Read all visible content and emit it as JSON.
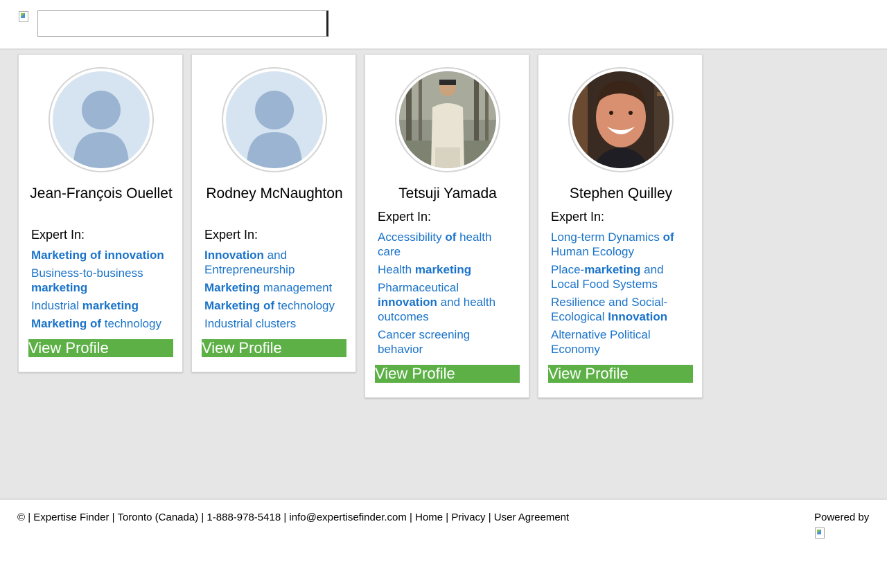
{
  "header": {
    "logo_icon": "broken-image-icon",
    "search": {
      "value": "",
      "placeholder": ""
    }
  },
  "experts": [
    {
      "name": "Jean-François Ouellet",
      "photo": "default-silhouette",
      "expert_label": "Expert In:",
      "topics": [
        [
          {
            "t": "Marketing of innovation",
            "b": true
          }
        ],
        [
          {
            "t": "Business-to-business ",
            "b": false
          },
          {
            "t": "marketing",
            "b": true
          }
        ],
        [
          {
            "t": "Industrial ",
            "b": false
          },
          {
            "t": "marketing",
            "b": true
          }
        ],
        [
          {
            "t": "Marketing of",
            "b": true
          },
          {
            "t": " technology",
            "b": false
          }
        ]
      ],
      "button": "View Profile"
    },
    {
      "name": "Rodney McNaughton",
      "photo": "default-silhouette",
      "expert_label": "Expert In:",
      "topics": [
        [
          {
            "t": "Innovation",
            "b": true
          },
          {
            "t": " and Entrepreneurship",
            "b": false
          }
        ],
        [
          {
            "t": "Marketing",
            "b": true
          },
          {
            "t": " management",
            "b": false
          }
        ],
        [
          {
            "t": "Marketing of",
            "b": true
          },
          {
            "t": " technology",
            "b": false
          }
        ],
        [
          {
            "t": "Industrial clusters",
            "b": false
          }
        ]
      ],
      "button": "View Profile"
    },
    {
      "name": "Tetsuji Yamada",
      "photo": "portrait-trees",
      "expert_label": "Expert In:",
      "topics": [
        [
          {
            "t": "Accessibility ",
            "b": false
          },
          {
            "t": "of",
            "b": true
          },
          {
            "t": " health care",
            "b": false
          }
        ],
        [
          {
            "t": "Health ",
            "b": false
          },
          {
            "t": "marketing",
            "b": true
          }
        ],
        [
          {
            "t": "Pharmaceutical ",
            "b": false
          },
          {
            "t": "innovation",
            "b": true
          },
          {
            "t": " and health outcomes",
            "b": false
          }
        ],
        [
          {
            "t": "Cancer screening behavior",
            "b": false
          }
        ]
      ],
      "button": "View Profile"
    },
    {
      "name": "Stephen Quilley",
      "photo": "portrait-bookshelf",
      "expert_label": "Expert In:",
      "topics": [
        [
          {
            "t": "Long-term Dynamics ",
            "b": false
          },
          {
            "t": "of",
            "b": true
          },
          {
            "t": " Human Ecology",
            "b": false
          }
        ],
        [
          {
            "t": "Place-",
            "b": false
          },
          {
            "t": "marketing",
            "b": true
          },
          {
            "t": " and Local Food Systems",
            "b": false
          }
        ],
        [
          {
            "t": "Resilience and Social-Ecological ",
            "b": false
          },
          {
            "t": "Innovation",
            "b": true
          }
        ],
        [
          {
            "t": "Alternative Political Economy",
            "b": false
          }
        ]
      ],
      "button": "View Profile"
    }
  ],
  "footer": {
    "copyright": "© | Expertise Finder | Toronto (Canada) | 1-888-978-5418 | ",
    "email": "info@expertisefinder.com",
    "sep1": " | ",
    "home": "Home",
    "sep2": " | ",
    "privacy": "Privacy",
    "sep3": " | ",
    "agreement": "User Agreement",
    "powered_by": "Powered by",
    "powered_logo_icon": "broken-image-icon"
  },
  "colors": {
    "link": "#1a73c9",
    "button_green": "#5cb046",
    "page_bg": "#e6e6e6"
  }
}
